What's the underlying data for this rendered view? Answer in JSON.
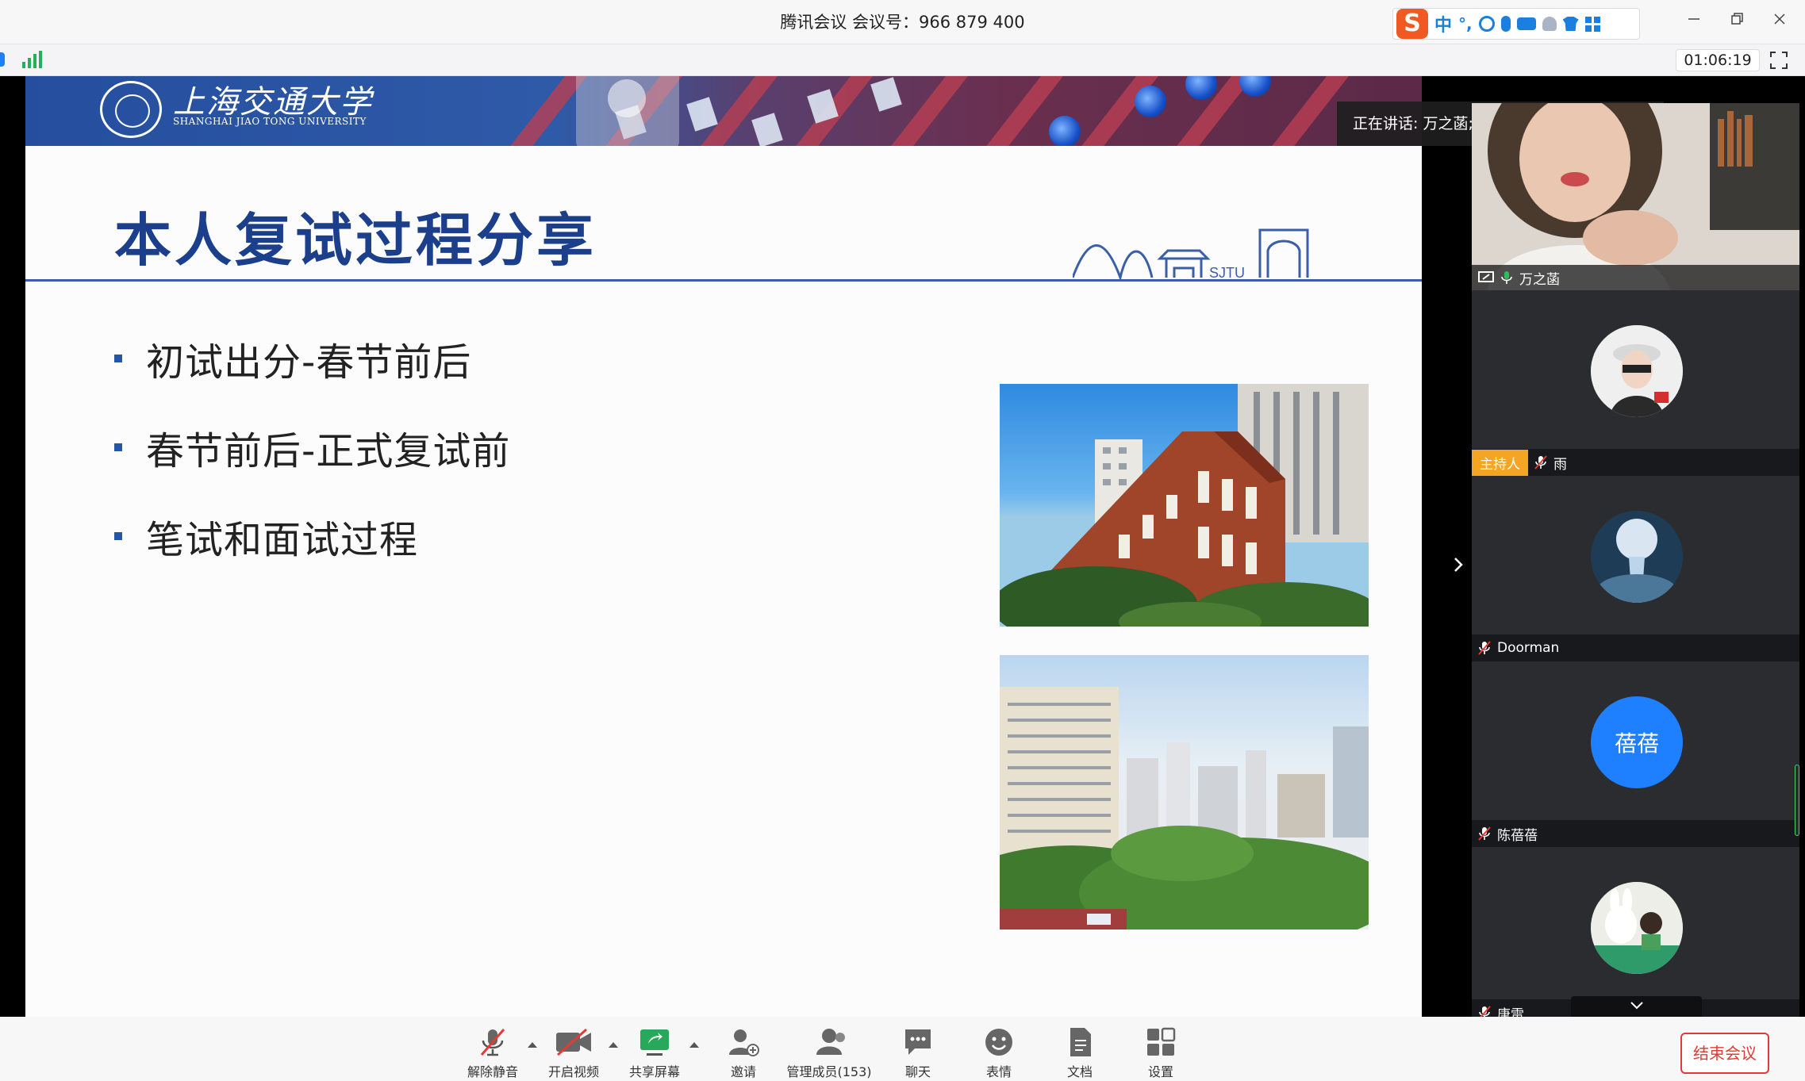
{
  "window": {
    "title": "腾讯会议 会议号：966 879 400",
    "ime_label": "中",
    "timer": "01:06:19"
  },
  "slide": {
    "logo_cn": "上海交通大学",
    "logo_en": "SHANGHAI JIAO TONG UNIVERSITY",
    "title": "本人复试过程分享",
    "skyline_label": "SJTU",
    "bullets": [
      "初试出分-春节前后",
      "春节前后-正式复试前",
      "笔试和面试过程"
    ]
  },
  "speaking": "正在讲话: 万之菡;",
  "participants": [
    {
      "name": "万之菡",
      "role": "",
      "mic": "on",
      "video": true
    },
    {
      "name": "雨",
      "role": "主持人",
      "mic": "muted",
      "video": false
    },
    {
      "name": "Doorman",
      "role": "",
      "mic": "muted",
      "video": false
    },
    {
      "name": "陈蓓蓓",
      "role": "",
      "mic": "muted",
      "video": false,
      "initials": "蓓蓓"
    },
    {
      "name": "唐雷",
      "role": "",
      "mic": "muted",
      "video": false
    }
  ],
  "toolbar": {
    "unmute": "解除静音",
    "video": "开启视频",
    "share": "共享屏幕",
    "invite": "邀请",
    "members": "管理成员(153)",
    "chat": "聊天",
    "emoji": "表情",
    "docs": "文档",
    "settings": "设置",
    "end": "结束会议"
  },
  "colors": {
    "accent": "#1e80ff",
    "end_red": "#e53935",
    "host_badge": "#f5a524",
    "slide_title": "#1c3f8b"
  }
}
